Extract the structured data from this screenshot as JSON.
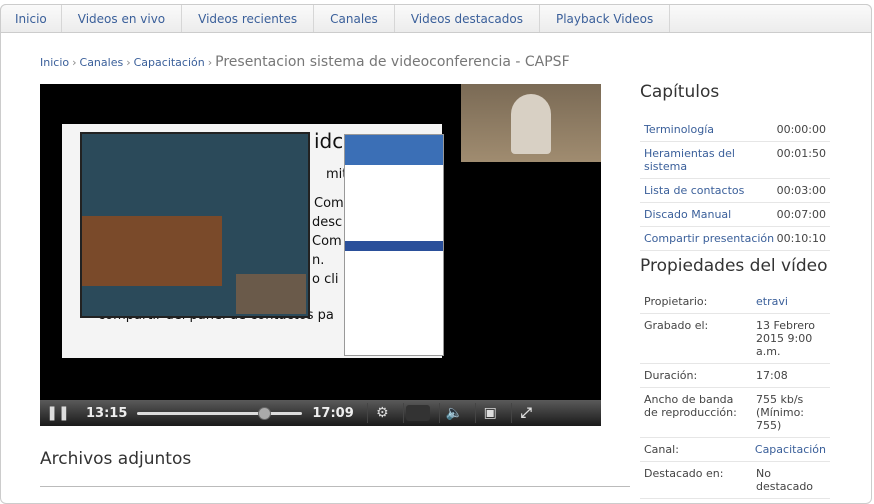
{
  "nav": [
    "Inicio",
    "Videos en vivo",
    "Videos recientes",
    "Canales",
    "Videos destacados",
    "Playback Videos"
  ],
  "breadcrumb": {
    "items": [
      "Inicio",
      "Canales",
      "Capacitación"
    ],
    "current": "Presentacion sistema de videoconferencia - CAPSF"
  },
  "player": {
    "current_time": "13:15",
    "total_time": "17:09",
    "progress": 0.77,
    "slide_text": [
      "idc",
      "mitir'",
      "Com",
      "desc",
      "Com",
      "n.",
      "o cli",
      "compartir del panel de contactos pa"
    ]
  },
  "chapters": {
    "title": "Capítulos",
    "items": [
      {
        "label": "Terminología",
        "time": "00:00:00"
      },
      {
        "label": "Heramientas del sistema",
        "time": "00:01:50"
      },
      {
        "label": "Lista de contactos",
        "time": "00:03:00"
      },
      {
        "label": "Discado Manual",
        "time": "00:07:00"
      },
      {
        "label": "Compartir presentación",
        "time": "00:10:10"
      }
    ]
  },
  "properties": {
    "title": "Propiedades del vídeo",
    "items": [
      {
        "label": "Propietario:",
        "value": "etravi",
        "link": true
      },
      {
        "label": "Grabado el:",
        "value": "13 Febrero 2015 9:00 a.m.",
        "link": false
      },
      {
        "label": "Duración:",
        "value": "17:08",
        "link": false
      },
      {
        "label": "Ancho de banda de reproducción:",
        "value": "755 kb/s (Mínimo: 755)",
        "link": false
      },
      {
        "label": "Canal:",
        "value": "Capacitación",
        "link": true
      },
      {
        "label": "Destacado en:",
        "value": "No destacado",
        "link": false
      }
    ]
  },
  "attachments": {
    "title": "Archivos adjuntos"
  }
}
